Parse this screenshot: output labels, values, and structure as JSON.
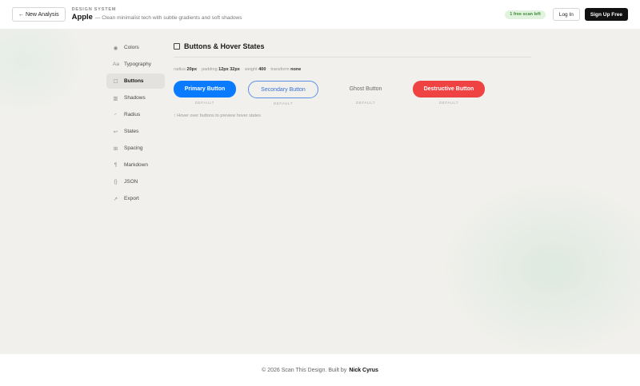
{
  "header": {
    "back_label": "← New Analysis",
    "eyebrow": "DESIGN SYSTEM",
    "brand_name": "Apple",
    "brand_description": "— Clean minimalist tech with subtle gradients and soft shadows",
    "scan_badge": "1 free scan left",
    "login_label": "Log In",
    "signup_label": "Sign Up Free"
  },
  "sidebar": {
    "items": [
      {
        "label": "Colors",
        "icon": "◉",
        "icon_name": "colors-icon"
      },
      {
        "label": "Typography",
        "icon": "Aa",
        "icon_name": "typography-icon"
      },
      {
        "label": "Buttons",
        "icon": "☐",
        "icon_name": "buttons-icon"
      },
      {
        "label": "Shadows",
        "icon": "▥",
        "icon_name": "shadows-icon"
      },
      {
        "label": "Radius",
        "icon": "◜",
        "icon_name": "radius-icon"
      },
      {
        "label": "States",
        "icon": "↩",
        "icon_name": "states-icon"
      },
      {
        "label": "Spacing",
        "icon": "⊞",
        "icon_name": "spacing-icon"
      },
      {
        "label": "Markdown",
        "icon": "¶",
        "icon_name": "markdown-icon"
      },
      {
        "label": "JSON",
        "icon": "{}",
        "icon_name": "json-icon"
      },
      {
        "label": "Export",
        "icon": "↗",
        "icon_name": "export-icon"
      }
    ],
    "active_index": 2
  },
  "section": {
    "title": "Buttons & Hover States",
    "meta": {
      "radius_label": "radius",
      "radius_value": "20px",
      "padding_label": "padding",
      "padding_value": "12px 32px",
      "weight_label": "weight",
      "weight_value": "400",
      "transform_label": "transform",
      "transform_value": "none"
    },
    "buttons": {
      "primary": "Primary Button",
      "secondary": "Secondary Button",
      "ghost": "Ghost Button",
      "destructive": "Destructive Button",
      "state_label": "DEFAULT"
    },
    "hint": "↑ Hover over buttons to preview hover states"
  },
  "colors": {
    "primary": "#0a7aff",
    "destructive": "#ef4343",
    "secondary_border": "#5a8fe6",
    "badge_bg": "#e1f3df",
    "badge_text": "#3f8c3a"
  },
  "footer": {
    "text": "© 2026 Scan This Design. Built by",
    "author": "Nick Cyrus"
  }
}
